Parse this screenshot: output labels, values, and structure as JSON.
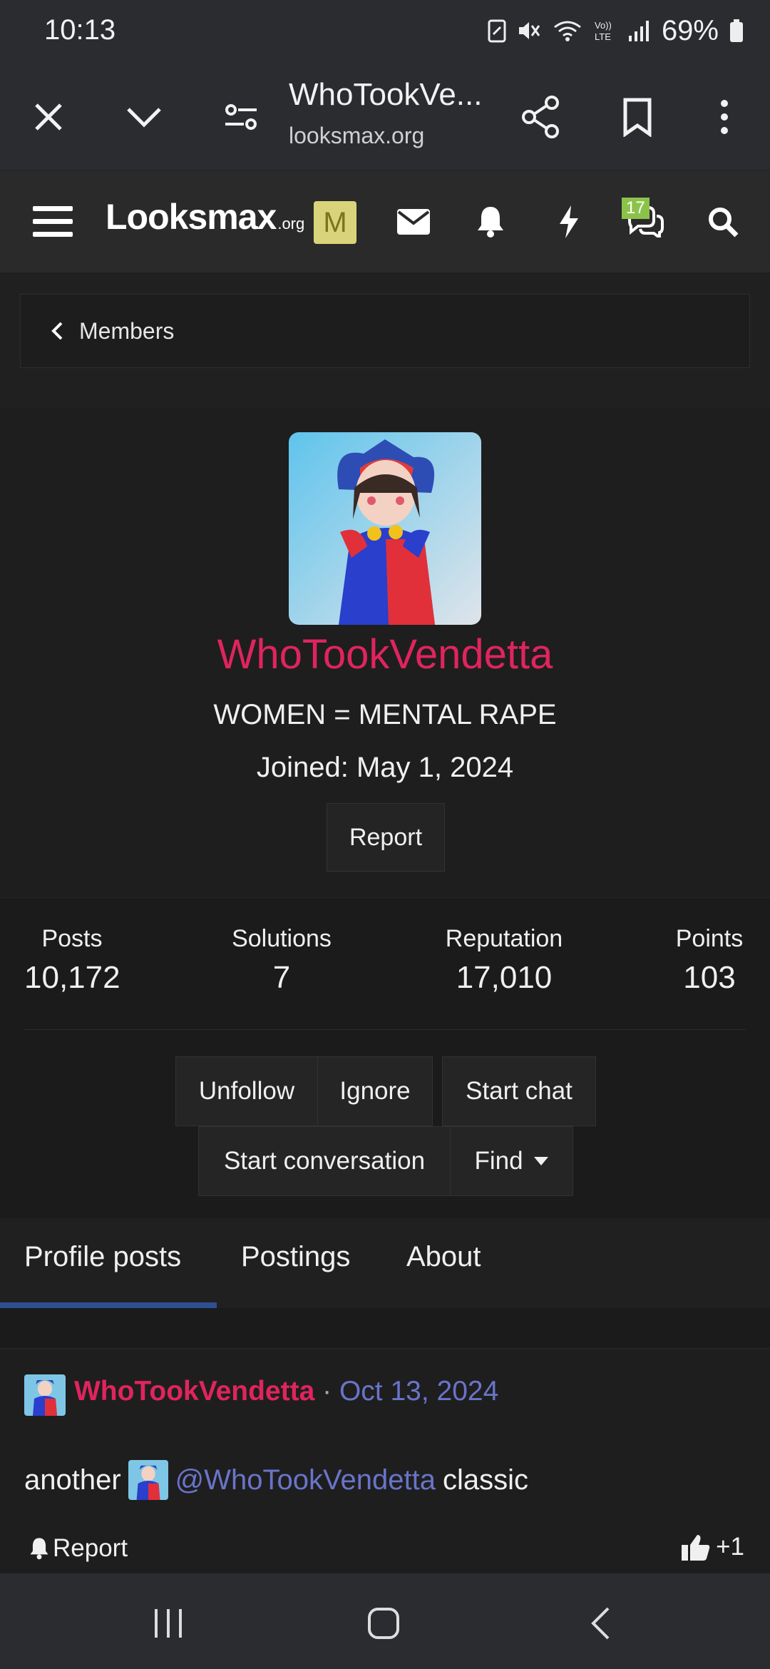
{
  "status": {
    "time": "10:13",
    "battery": "69%"
  },
  "browser": {
    "tab_title": "WhoTookVe...",
    "url": "looksmax.org"
  },
  "site": {
    "logo_main": "Looksmax",
    "logo_tld": ".org",
    "badge_letter": "M",
    "chat_count": "17"
  },
  "breadcrumb": {
    "label": "Members"
  },
  "profile": {
    "username": "WhoTookVendetta",
    "title": "WOMEN = MENTAL RAPE",
    "joined": "Joined: May 1, 2024",
    "report_label": "Report"
  },
  "stats": [
    {
      "label": "Posts",
      "value": "10,172"
    },
    {
      "label": "Solutions",
      "value": "7"
    },
    {
      "label": "Reputation",
      "value": "17,010"
    },
    {
      "label": "Points",
      "value": "103"
    }
  ],
  "actions": {
    "unfollow": "Unfollow",
    "ignore": "Ignore",
    "start_chat": "Start chat",
    "start_conversation": "Start conversation",
    "find": "Find"
  },
  "tabs": [
    {
      "label": "Profile posts",
      "active": true
    },
    {
      "label": "Postings",
      "active": false
    },
    {
      "label": "About",
      "active": false
    }
  ],
  "post": {
    "author": "WhoTookVendetta",
    "separator": "·",
    "date": "Oct 13, 2024",
    "text_before": "another",
    "mention": "@WhoTookVendetta",
    "text_after": "classic",
    "report_label": "Report",
    "like_count": "+1"
  },
  "colors": {
    "username": "#e0245e",
    "link": "#6a74c9",
    "tab_accent": "#2f4f93",
    "badge": "#d9d47a",
    "chat_badge": "#8bc34a"
  }
}
